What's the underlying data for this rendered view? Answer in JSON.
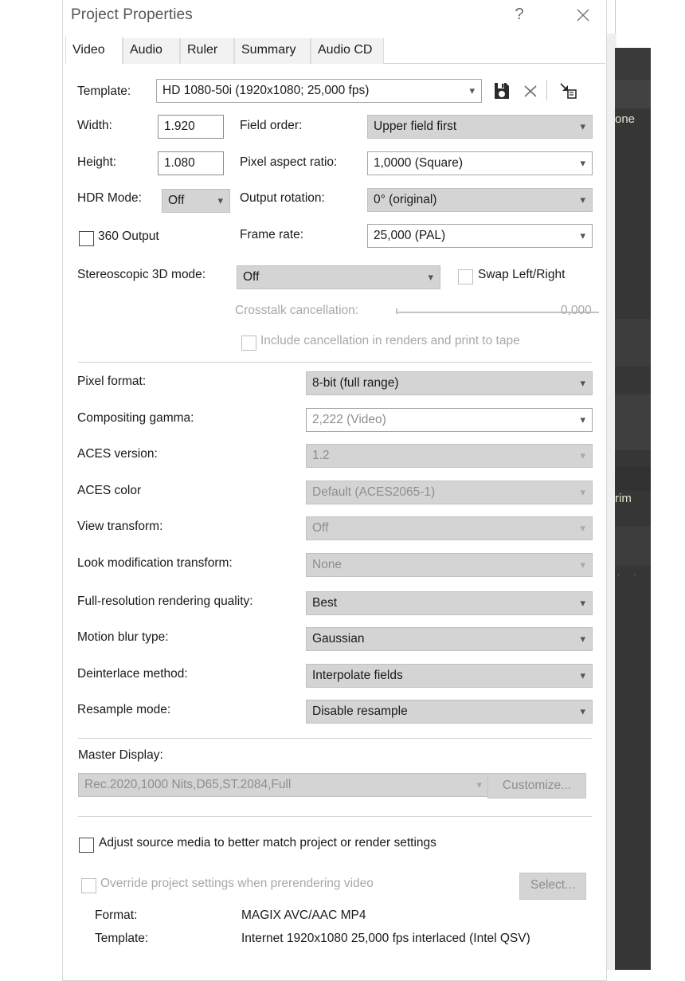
{
  "background_app": {
    "fragment_text_1": "one",
    "fragment_text_2": "rim"
  },
  "dialog": {
    "title": "Project Properties",
    "help_label": "?",
    "close_label": "✕",
    "tabs": [
      {
        "label": "Video",
        "active": true
      },
      {
        "label": "Audio",
        "active": false
      },
      {
        "label": "Ruler",
        "active": false
      },
      {
        "label": "Summary",
        "active": false
      },
      {
        "label": "Audio CD",
        "active": false
      }
    ],
    "template_row": {
      "label": "Template:",
      "value": "HD 1080-50i (1920x1080; 25,000 fps)",
      "save_icon": "floppy-disk-save-icon",
      "delete_icon": "delete-x-icon",
      "import_icon": "import-to-box-icon"
    },
    "width": {
      "label": "Width:",
      "value": "1.920"
    },
    "height": {
      "label": "Height:",
      "value": "1.080"
    },
    "field_order": {
      "label": "Field order:",
      "value": "Upper field first"
    },
    "pixel_aspect_ratio": {
      "label": "Pixel aspect ratio:",
      "value": "1,0000 (Square)"
    },
    "hdr_mode": {
      "label": "HDR Mode:",
      "value": "Off"
    },
    "output_rotation": {
      "label": "Output rotation:",
      "value": "0° (original)"
    },
    "output_360": {
      "label": "360 Output",
      "checked": false
    },
    "frame_rate": {
      "label": "Frame rate:",
      "value": "25,000 (PAL)"
    },
    "stereoscopic": {
      "label": "Stereoscopic 3D mode:",
      "value": "Off"
    },
    "swap_left_right": {
      "label": "Swap Left/Right",
      "checked": false
    },
    "crosstalk": {
      "label": "Crosstalk cancellation:",
      "value": "0,000"
    },
    "include_cancellation": {
      "label": "Include cancellation in renders and print to tape",
      "checked": false
    },
    "settings_rows": [
      {
        "label": "Pixel format:",
        "value": "8-bit (full range)",
        "style": "enabled"
      },
      {
        "label": "Compositing gamma:",
        "value": "2,222 (Video)",
        "style": "white-disabled"
      },
      {
        "label": "ACES version:",
        "value": "1.2",
        "style": "disabled"
      },
      {
        "label": "ACES color",
        "value": "Default (ACES2065-1)",
        "style": "disabled"
      },
      {
        "label": "View transform:",
        "value": "Off",
        "style": "disabled"
      },
      {
        "label": "Look modification transform:",
        "value": "None",
        "style": "disabled"
      },
      {
        "label": "Full-resolution rendering quality:",
        "value": "Best",
        "style": "enabled"
      },
      {
        "label": "Motion blur type:",
        "value": "Gaussian",
        "style": "enabled"
      },
      {
        "label": "Deinterlace method:",
        "value": "Interpolate fields",
        "style": "enabled"
      },
      {
        "label": "Resample mode:",
        "value": "Disable resample",
        "style": "enabled"
      }
    ],
    "master_display": {
      "label": "Master Display:",
      "value": "Rec.2020,1000 Nits,D65,ST.2084,Full",
      "customize_label": "Customize..."
    },
    "adjust_source_media": {
      "label": "Adjust source media to better match project or render settings",
      "checked": false
    },
    "override_prerender": {
      "label": "Override project settings when prerendering video",
      "checked": false,
      "select_label": "Select..."
    },
    "format_info": {
      "format_label": "Format:",
      "format_value": "MAGIX AVC/AAC MP4",
      "template_label": "Template:",
      "template_value": "Internet 1920x1080 25,000 fps interlaced (Intel QSV)"
    }
  }
}
